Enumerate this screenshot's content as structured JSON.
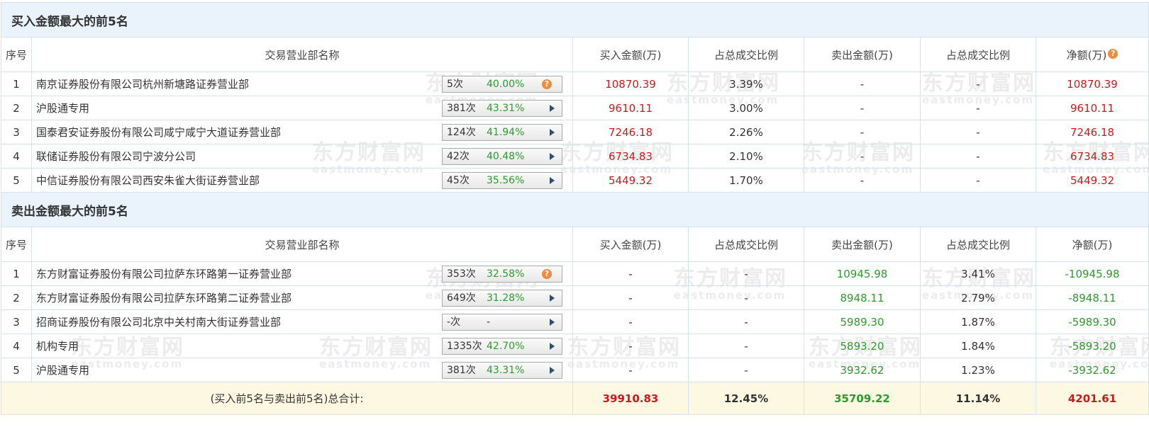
{
  "watermark": {
    "cn": "东方财富网",
    "en": "eastmoney.com"
  },
  "buy_section": {
    "title": "买入金额最大的前5名",
    "headers": {
      "seq": "序号",
      "name": "交易营业部名称",
      "buy": "买入金额(万)",
      "buy_ratio": "占总成交比例",
      "sell": "卖出金额(万)",
      "sell_ratio": "占总成交比例",
      "net": "净额(万)"
    },
    "rows": [
      {
        "seq": "1",
        "name": "南京证券股份有限公司杭州新塘路证券营业部",
        "count": "5次",
        "pct": "40.00%",
        "icon": "question",
        "buy": "10870.39",
        "buy_ratio": "3.39%",
        "sell": "-",
        "sell_ratio": "-",
        "net": "10870.39"
      },
      {
        "seq": "2",
        "name": "沪股通专用",
        "count": "381次",
        "pct": "43.31%",
        "icon": "arrow",
        "buy": "9610.11",
        "buy_ratio": "3.00%",
        "sell": "-",
        "sell_ratio": "-",
        "net": "9610.11"
      },
      {
        "seq": "3",
        "name": "国泰君安证券股份有限公司咸宁咸宁大道证券营业部",
        "count": "124次",
        "pct": "41.94%",
        "icon": "arrow",
        "buy": "7246.18",
        "buy_ratio": "2.26%",
        "sell": "-",
        "sell_ratio": "-",
        "net": "7246.18"
      },
      {
        "seq": "4",
        "name": "联储证券股份有限公司宁波分公司",
        "count": "42次",
        "pct": "40.48%",
        "icon": "arrow",
        "buy": "6734.83",
        "buy_ratio": "2.10%",
        "sell": "-",
        "sell_ratio": "-",
        "net": "6734.83"
      },
      {
        "seq": "5",
        "name": "中信证券股份有限公司西安朱雀大街证券营业部",
        "count": "45次",
        "pct": "35.56%",
        "icon": "arrow",
        "buy": "5449.32",
        "buy_ratio": "1.70%",
        "sell": "-",
        "sell_ratio": "-",
        "net": "5449.32"
      }
    ]
  },
  "sell_section": {
    "title": "卖出金额最大的前5名",
    "headers": {
      "seq": "序号",
      "name": "交易营业部名称",
      "buy": "买入金额(万)",
      "buy_ratio": "占总成交比例",
      "sell": "卖出金额(万)",
      "sell_ratio": "占总成交比例",
      "net": "净额(万)"
    },
    "rows": [
      {
        "seq": "1",
        "name": "东方财富证券股份有限公司拉萨东环路第一证券营业部",
        "count": "353次",
        "pct": "32.58%",
        "icon": "question",
        "buy": "-",
        "buy_ratio": "-",
        "sell": "10945.98",
        "sell_ratio": "3.41%",
        "net": "-10945.98"
      },
      {
        "seq": "2",
        "name": "东方财富证券股份有限公司拉萨东环路第二证券营业部",
        "count": "649次",
        "pct": "31.28%",
        "icon": "arrow",
        "buy": "-",
        "buy_ratio": "-",
        "sell": "8948.11",
        "sell_ratio": "2.79%",
        "net": "-8948.11"
      },
      {
        "seq": "3",
        "name": "招商证券股份有限公司北京中关村南大街证券营业部",
        "count": "-次",
        "pct": "-",
        "icon": "arrow",
        "buy": "-",
        "buy_ratio": "-",
        "sell": "5989.30",
        "sell_ratio": "1.87%",
        "net": "-5989.30"
      },
      {
        "seq": "4",
        "name": "机构专用",
        "count": "1335次",
        "pct": "42.70%",
        "icon": "arrow",
        "buy": "-",
        "buy_ratio": "-",
        "sell": "5893.20",
        "sell_ratio": "1.84%",
        "net": "-5893.20"
      },
      {
        "seq": "5",
        "name": "沪股通专用",
        "count": "381次",
        "pct": "43.31%",
        "icon": "arrow",
        "buy": "-",
        "buy_ratio": "-",
        "sell": "3932.62",
        "sell_ratio": "1.23%",
        "net": "-3932.62"
      }
    ]
  },
  "total": {
    "label": "(买入前5名与卖出前5名)总合计:",
    "buy": "39910.83",
    "buy_ratio": "12.45%",
    "sell": "35709.22",
    "sell_ratio": "11.14%",
    "net": "4201.61"
  },
  "colors": {
    "positive": "#d0181c",
    "negative": "#2c9a2c",
    "section_bg": "#eaf3fc",
    "total_bg": "#fdf8e1",
    "border": "#d4e2f0",
    "help_icon": "#f08a3c"
  }
}
